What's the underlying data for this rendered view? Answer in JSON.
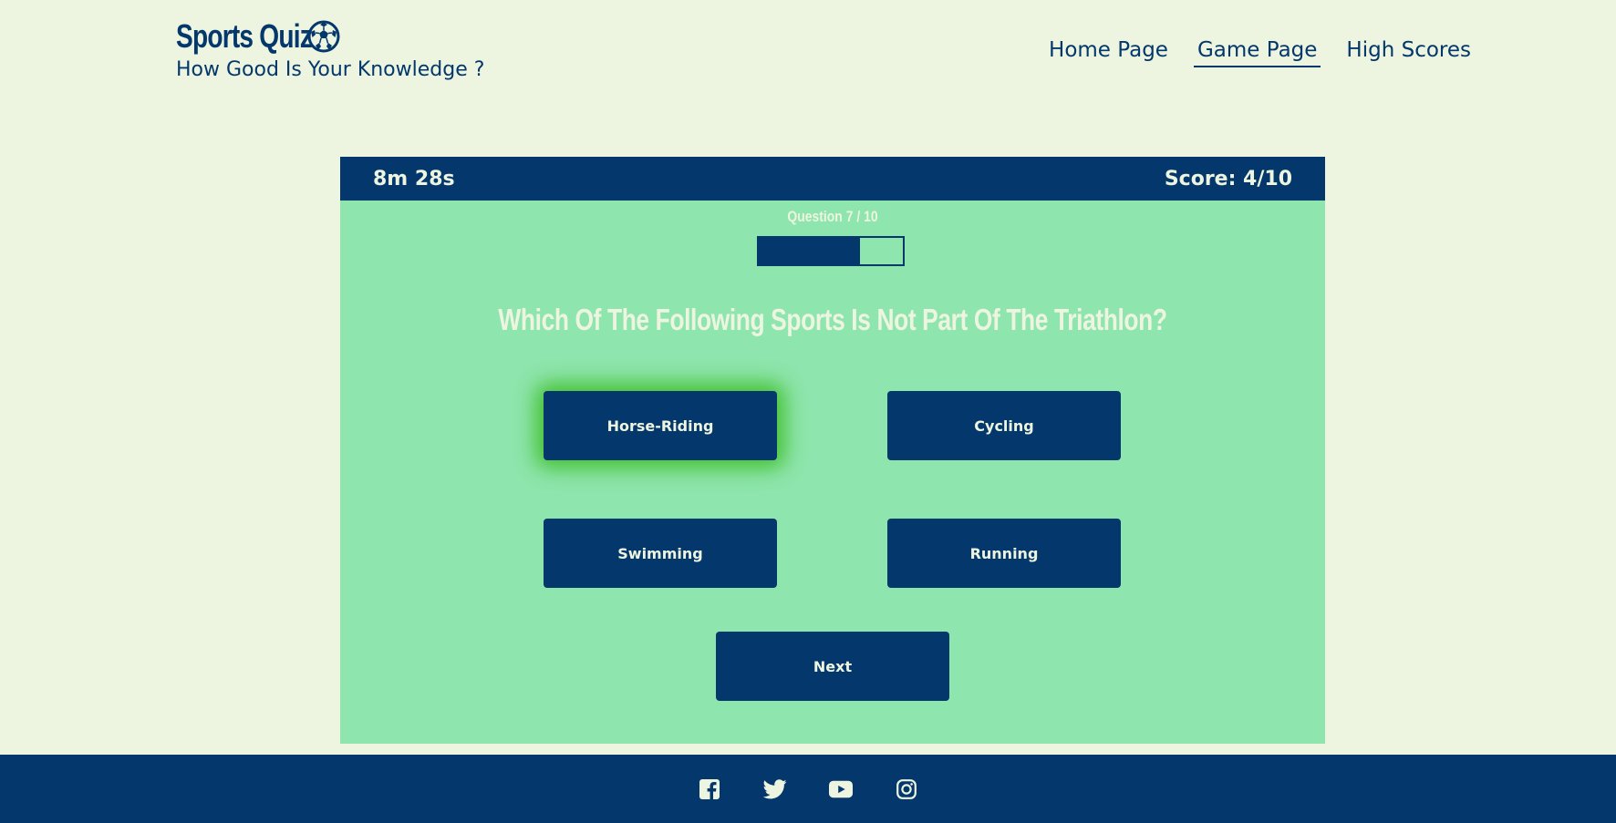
{
  "header": {
    "title": "Sports Quiz",
    "subtitle": "How Good Is Your Knowledge ?",
    "logo_icon": "soccer-ball-icon"
  },
  "nav": {
    "items": [
      {
        "label": "Home Page",
        "active": false
      },
      {
        "label": "Game Page",
        "active": true
      },
      {
        "label": "High Scores",
        "active": false
      }
    ]
  },
  "quiz": {
    "timer": "8m 28s",
    "score": "Score: 4/10",
    "question_counter": "Question 7 / 10",
    "progress": 0.7,
    "question": "Which Of The Following Sports Is Not Part Of The Triathlon?",
    "answers": [
      {
        "label": "Horse-Riding",
        "selected": true
      },
      {
        "label": "Cycling",
        "selected": false
      },
      {
        "label": "Swimming",
        "selected": false
      },
      {
        "label": "Running",
        "selected": false
      }
    ],
    "next_label": "Next"
  },
  "footer": {
    "social_icons": [
      "facebook-icon",
      "twitter-icon",
      "youtube-icon",
      "instagram-icon"
    ]
  },
  "colors": {
    "page_background": "#edf5e0",
    "primary": "#04376b",
    "quiz_background": "#8fe5ae",
    "selected_glow": "#3fbf2a"
  }
}
